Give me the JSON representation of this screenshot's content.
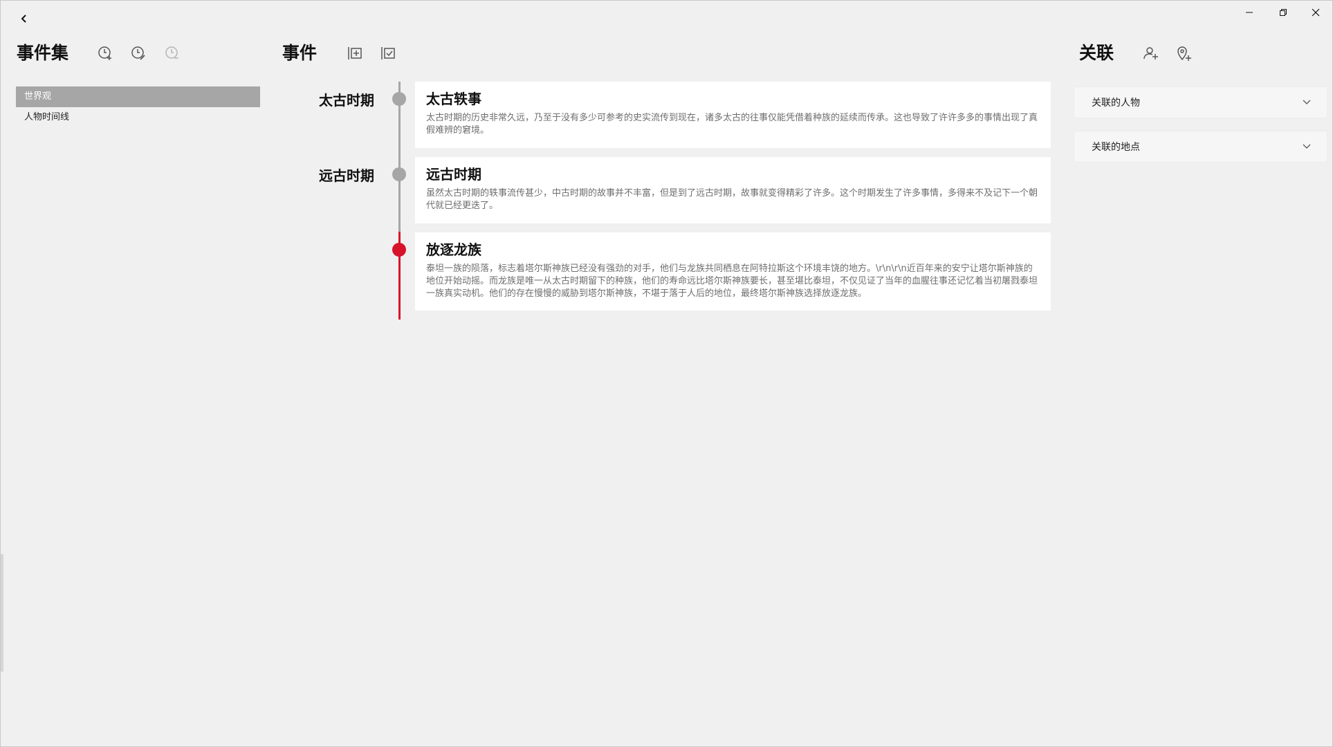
{
  "titlebar": {
    "back_icon": "chevron-left-icon",
    "controls": [
      "minimize-icon",
      "restore-icon",
      "close-icon"
    ]
  },
  "event_sets": {
    "title": "事件集",
    "toolbar_icons": [
      "clock-add-icon",
      "clock-edit-icon",
      "clock-remove-icon"
    ],
    "items": [
      {
        "label": "世界观",
        "selected": true
      },
      {
        "label": "人物时间线",
        "selected": false
      }
    ]
  },
  "events": {
    "title": "事件",
    "toolbar_icons": [
      "add-event-icon",
      "checklist-icon"
    ],
    "items": [
      {
        "era": "太古时期",
        "title": "太古轶事",
        "body": "太古时期的历史非常久远，乃至于没有多少可参考的史实流传到现在，诸多太古的往事仅能凭借着种族的延续而传承。这也导致了许许多多的事情出现了真假难辨的窘境。",
        "active": false
      },
      {
        "era": "远古时期",
        "title": "远古时期",
        "body": "虽然太古时期的轶事流传甚少，中古时期的故事并不丰富，但是到了远古时期，故事就变得精彩了许多。这个时期发生了许多事情，多得来不及记下一个朝代就已经更迭了。",
        "active": false
      },
      {
        "era": "",
        "title": "放逐龙族",
        "body": "泰坦一族的陨落，标志着塔尔斯神族已经没有强劲的对手，他们与龙族共同栖息在阿特拉斯这个环境丰饶的地方。\\r\\n\\r\\n近百年来的安宁让塔尔斯神族的地位开始动摇。而龙族是唯一从太古时期留下的种族，他们的寿命远比塔尔斯神族要长，甚至堪比泰坦，不仅见证了当年的血腥往事还记忆着当初屠戮泰坦一族真实动机。他们的存在慢慢的威胁到塔尔斯神族，不堪于落于人后的地位，最终塔尔斯神族选择放逐龙族。",
        "active": true
      }
    ]
  },
  "relations": {
    "title": "关联",
    "toolbar_icons": [
      "add-person-icon",
      "add-location-icon"
    ],
    "sections": [
      {
        "label": "关联的人物"
      },
      {
        "label": "关联的地点"
      }
    ]
  },
  "colors": {
    "accent": "#d7122a",
    "timeline_gray": "#a6a6a6",
    "selected_bg": "#a6a6a6",
    "background": "#f0f0f0",
    "card_bg": "#ffffff"
  }
}
